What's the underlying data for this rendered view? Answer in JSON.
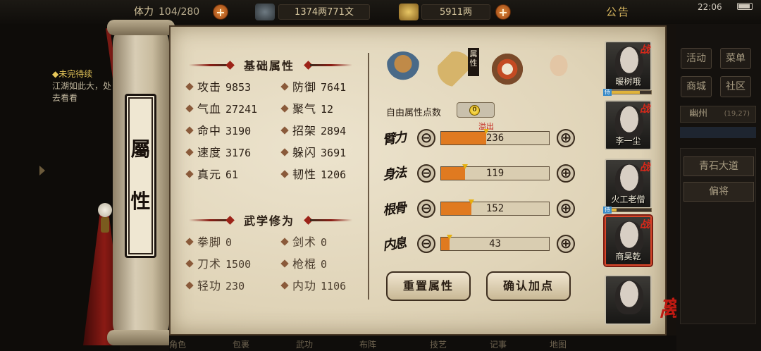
{
  "topbar": {
    "stamina_label": "体力",
    "stamina_value": "104/280",
    "copper": "1374两771文",
    "gold": "5911两",
    "notice": "公告",
    "clock": "22:06",
    "plus_symbol": "+"
  },
  "quest": {
    "title": "◆未完待续",
    "text": "江湖如此大，处去看看"
  },
  "plaque": {
    "char1": "屬",
    "char2": "性"
  },
  "basic": {
    "title": "基础属性",
    "stats": [
      {
        "label": "攻击",
        "value": "9853"
      },
      {
        "label": "防御",
        "value": "7641"
      },
      {
        "label": "气血",
        "value": "27241"
      },
      {
        "label": "聚气",
        "value": "12"
      },
      {
        "label": "命中",
        "value": "3190"
      },
      {
        "label": "招架",
        "value": "2894"
      },
      {
        "label": "速度",
        "value": "3176"
      },
      {
        "label": "躲闪",
        "value": "3691"
      },
      {
        "label": "真元",
        "value": "61"
      },
      {
        "label": "韧性",
        "value": "1206"
      }
    ]
  },
  "martial": {
    "title": "武学修为",
    "stats": [
      {
        "label": "拳脚",
        "value": "0"
      },
      {
        "label": "剑术",
        "value": "0"
      },
      {
        "label": "刀术",
        "value": "1500"
      },
      {
        "label": "枪棍",
        "value": "0"
      },
      {
        "label": "轻功",
        "value": "230"
      },
      {
        "label": "内功",
        "value": "1106"
      }
    ]
  },
  "attr_panel": {
    "tab_label": "属性",
    "free_points_label": "自由属性点数",
    "free_points_value": "0",
    "overflow_label": "溢出",
    "rows": [
      {
        "name": "臂力",
        "value": "236",
        "fill": 0.42
      },
      {
        "name": "身法",
        "value": "119",
        "fill": 0.22
      },
      {
        "name": "根骨",
        "value": "152",
        "fill": 0.28
      },
      {
        "name": "内息",
        "value": "43",
        "fill": 0.08
      }
    ],
    "minus_symbol": "⊖",
    "plus_symbol": "⊕",
    "reset_button": "重置属性",
    "confirm_button": "确认加点"
  },
  "team": {
    "zhan": "战",
    "shi": "侍",
    "members": [
      {
        "name": "暖树哦",
        "shi_fill": 0.75
      },
      {
        "name": "李一尘",
        "shi_fill": 0
      },
      {
        "name": "火工老僧",
        "shi_fill": 0.25
      },
      {
        "name": "商昊乾",
        "shi_fill": 0
      },
      {
        "name": "",
        "shi_fill": 0
      }
    ],
    "leave": "离开"
  },
  "right_menu": {
    "items": [
      "活动",
      "菜单",
      "商城",
      "社区"
    ],
    "location": "幽州",
    "coords": "(19,27)",
    "loc_buttons": [
      "青石大道",
      "偏将"
    ]
  },
  "bottom_menu": [
    "角色",
    "包裹",
    "武功",
    "布阵",
    "技艺",
    "记事",
    "地图"
  ],
  "colors": {
    "paper": "#e3d8bf",
    "bar_fill": "#e07a20",
    "accent_red": "#c01a12",
    "gold_text": "#d9b860"
  }
}
